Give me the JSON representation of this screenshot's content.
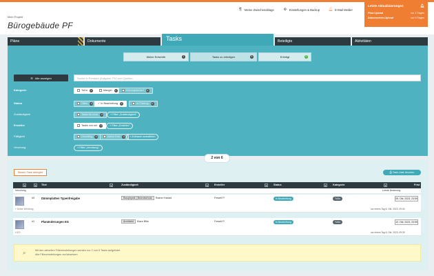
{
  "header": {
    "project_label": "Mein Projekt",
    "project_title": "Bürogebäude PF",
    "actions": [
      {
        "label": "Meine Zwischenablage",
        "icon": "clipboard-icon"
      },
      {
        "label": "Einstellungen & Backup",
        "icon": "gear-icon"
      },
      {
        "label": "E-Mail Melder",
        "icon": "bell-icon"
      }
    ]
  },
  "notifications": {
    "title": "Letzte Aktualisierungen",
    "items": [
      {
        "label": "Plan-Upload",
        "time": "vor 2 Tagen"
      },
      {
        "label": "Dokumenten-Upload",
        "time": "vor 9 Tagen"
      }
    ]
  },
  "tabs": [
    {
      "label": "Pläne"
    },
    {
      "label": "Dokumente"
    },
    {
      "label": "Tasks"
    },
    {
      "label": "Beteiligte"
    },
    {
      "label": "Aktivitäten"
    }
  ],
  "segments": [
    {
      "label": "Meine Entwürfe",
      "count": "1"
    },
    {
      "label": "Tasks zu erledigen",
      "count": "6"
    },
    {
      "label": "Erledigt",
      "count": "0"
    }
  ],
  "filters": {
    "show_all_label": "Alle anzeigen",
    "search_placeholder": "Suche in Pendant (Aufgabe, PV) und Quellen",
    "rows": {
      "kategorie": "Kategorie",
      "status": "Status",
      "zustaendigkeit": "Zuständigkeit",
      "ersteller": "Ersteller",
      "faelligkeit": "Fälligkeit",
      "verortung": "Verortung"
    },
    "chips": {
      "todo": "ToDo",
      "todo_count": "2",
      "mangel": "Mangel",
      "mangel_count": "1",
      "klaerungsbedarf": "Klärungsbedarf",
      "klaerungsbedarf_count": "0",
      "offen": "Offen",
      "offen_count": "0",
      "in_bearbeitung": "In Bearbeitung",
      "in_bearbeitung_count": "2",
      "in_pruefung": "In Prüfung",
      "in_pruefung_count": "0",
      "tasks_fuer_mich": "Tasks für mich",
      "tasks_fuer_mich_count": "0",
      "filter_zustaendigkeit": "Filter „Zuständigkeit\"",
      "tasks_von_mir": "Tasks von mir",
      "tasks_von_mir_count": "2",
      "filter_ersteller": "Filter „Ersteller\"",
      "ueberfaellig": "Überfällig",
      "ueberfaellig_count": "0",
      "keine_frist": "Keine Frist",
      "keine_frist_count": "0",
      "zeitraum": "Zeitraum auswählen",
      "filter_verortung": "Filter „Verortung\""
    }
  },
  "pager": "2 von 6",
  "list": {
    "new_task_label": "Neuen Task anlegen",
    "print_label": "Task-Liste drucken",
    "columns": [
      "Titel",
      "Zuständigkeit",
      "Ersteller",
      "Status",
      "Kategorie",
      "Frist"
    ],
    "subhead_left": "Verortung",
    "subhead_right": "Letzte Änderung",
    "rows": [
      {
        "num": "#5",
        "title": "Dämmplatten Typenfreigabe",
        "resp_tag": "Bauphysik | Brandschutz",
        "resp_name": "Rainer Harald",
        "creator": "Fewelt P.",
        "status": "In Bearbeitung",
        "category": "ToDo",
        "due": "05. Okt. 2023, 23:59",
        "sub_left": "+ Keine Verortung",
        "sub_right": "vor einem Tag  6. Okt. 2023, 09:04"
      },
      {
        "num": "#2",
        "title": "Planänderungen EG",
        "resp_tag": "Architekt",
        "resp_name": "Klara Blitz",
        "creator": "Fewelt P.",
        "status": "In Bearbeitung",
        "category": "ToDo",
        "due": "10. Okt. 2023, 23:59",
        "sub_left": "# EG",
        "sub_right": "vor einem Tag  6. Okt. 2023, 09:25"
      }
    ],
    "info_line1": "Mit den aktuellen Filtereinstellungen werden nur 2 von 6 Tasks aufgelistet.",
    "info_line2": "Alle Filtereinstellungen zurücksetzen"
  }
}
